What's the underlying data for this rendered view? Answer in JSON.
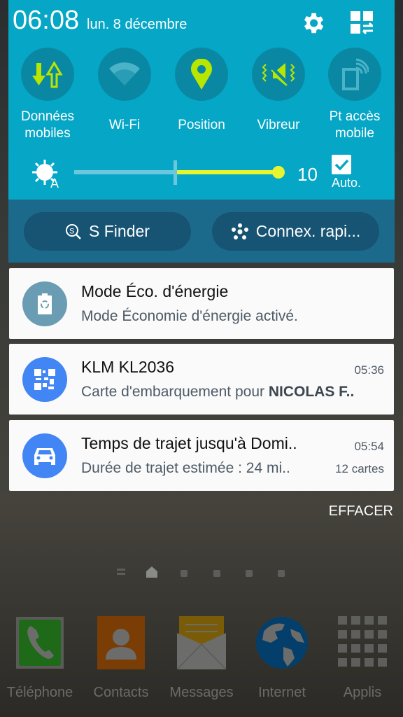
{
  "status": {
    "time": "06:08",
    "date": "lun. 8 décembre"
  },
  "toggles": [
    {
      "label": "Données mobiles",
      "icon": "mobile-data-icon",
      "active": true
    },
    {
      "label": "Wi-Fi",
      "icon": "wifi-icon",
      "active": false
    },
    {
      "label": "Position",
      "icon": "location-pin-icon",
      "active": true
    },
    {
      "label": "Vibreur",
      "icon": "vibrate-icon",
      "active": true
    },
    {
      "label": "Pt accès mobile",
      "icon": "hotspot-icon",
      "active": false
    }
  ],
  "brightness": {
    "value": "10",
    "level_percent": 100,
    "auto_label": "Auto.",
    "auto_checked": true
  },
  "buttons": {
    "sfinder": "S Finder",
    "quick_connect": "Connex. rapi..."
  },
  "notifications": [
    {
      "title": "Mode Éco. d'énergie",
      "text": "Mode Économie d'énergie activé.",
      "icon": "battery-eco-icon",
      "color": "#6a9db3"
    },
    {
      "title": "KLM KL2036",
      "text": "Carte d'embarquement pour ",
      "text_bold": "NICOLAS F..",
      "time": "05:36",
      "icon": "qr-code-icon",
      "color": "#4285f4"
    },
    {
      "title": "Temps de trajet jusqu'à Domi..",
      "text": "Durée de trajet estimée : 24 mi..",
      "time": "05:54",
      "count": "12 cartes",
      "icon": "car-icon",
      "color": "#4285f4"
    }
  ],
  "clear_label": "EFFACER",
  "dock": [
    {
      "label": "Téléphone"
    },
    {
      "label": "Contacts"
    },
    {
      "label": "Messages"
    },
    {
      "label": "Internet"
    },
    {
      "label": "Applis"
    }
  ],
  "colors": {
    "panel": "#05a6c6",
    "accent": "#e7f531",
    "toggle_bg": "#0a88a3"
  }
}
